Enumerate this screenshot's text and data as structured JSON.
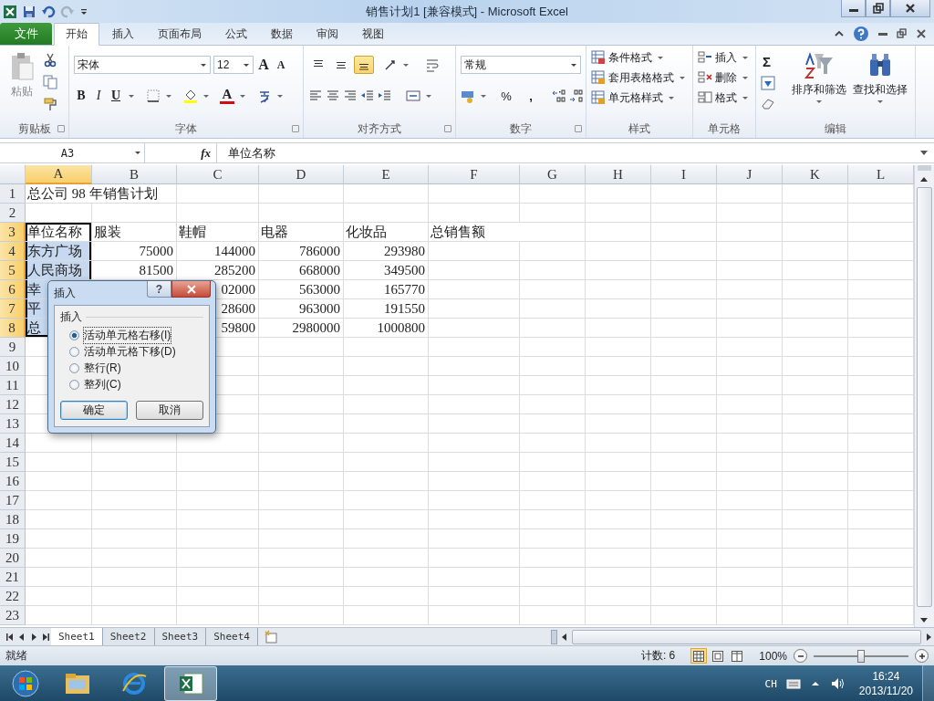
{
  "window": {
    "title": "销售计划1  [兼容模式]  -  Microsoft Excel"
  },
  "ribbon_tabs": [
    {
      "label": "文件",
      "kind": "file",
      "selected": false
    },
    {
      "label": "开始",
      "kind": "tab",
      "selected": true
    },
    {
      "label": "插入",
      "kind": "tab",
      "selected": false
    },
    {
      "label": "页面布局",
      "kind": "tab",
      "selected": false
    },
    {
      "label": "公式",
      "kind": "tab",
      "selected": false
    },
    {
      "label": "数据",
      "kind": "tab",
      "selected": false
    },
    {
      "label": "审阅",
      "kind": "tab",
      "selected": false
    },
    {
      "label": "视图",
      "kind": "tab",
      "selected": false
    }
  ],
  "clipboard": {
    "paste": "粘贴",
    "label": "剪贴板"
  },
  "font": {
    "name": "宋体",
    "size": "12",
    "grow": "A",
    "shrink": "A",
    "bold": "B",
    "italic": "I",
    "underline": "U",
    "color_letter": "A",
    "label": "字体"
  },
  "alignment": {
    "vertical": [
      {
        "kind": "top",
        "selected": false
      },
      {
        "kind": "middle",
        "selected": false
      },
      {
        "kind": "bottom",
        "selected": true
      }
    ],
    "label": "对齐方式"
  },
  "number": {
    "format": "常规",
    "percent": "%",
    "comma": ",",
    "label": "数字"
  },
  "styles": {
    "items": [
      "条件格式",
      "套用表格格式",
      "单元格样式"
    ],
    "label": "样式"
  },
  "cells": {
    "items": [
      "插入",
      "删除",
      "格式"
    ],
    "label": "单元格"
  },
  "editing": {
    "sum": "Σ",
    "items": [
      "排序和筛选",
      "查找和选择"
    ],
    "label": "编辑"
  },
  "formula_bar": {
    "name_box": "A3",
    "fx": "fx",
    "value": "单位名称"
  },
  "sheet": {
    "columns": [
      {
        "label": "A",
        "selected": true
      },
      {
        "label": "B",
        "selected": false
      },
      {
        "label": "C",
        "selected": false
      },
      {
        "label": "D",
        "selected": false
      },
      {
        "label": "E",
        "selected": false
      },
      {
        "label": "F",
        "selected": false
      },
      {
        "label": "G",
        "selected": false
      },
      {
        "label": "H",
        "selected": false
      },
      {
        "label": "I",
        "selected": false
      },
      {
        "label": "J",
        "selected": false
      },
      {
        "label": "K",
        "selected": false
      },
      {
        "label": "L",
        "selected": false
      }
    ],
    "rows": [
      {
        "num": "1",
        "selected": false,
        "cells": [
          {
            "text": "总公司 98 年销售计划",
            "kind": "text",
            "selected": false
          }
        ]
      },
      {
        "num": "2",
        "selected": false
      },
      {
        "num": "3",
        "selected": true,
        "cells": [
          {
            "text": "单位名称",
            "kind": "text",
            "selected": true
          },
          {
            "text": "服装",
            "kind": "text",
            "selected": false
          },
          {
            "text": "鞋帽",
            "kind": "text",
            "selected": false
          },
          {
            "text": "电器",
            "kind": "text",
            "selected": false
          },
          {
            "text": "化妆品",
            "kind": "text",
            "selected": false
          },
          {
            "text": "总销售额",
            "kind": "text",
            "selected": false
          }
        ]
      },
      {
        "num": "4",
        "selected": true,
        "cells": [
          {
            "text": "东方广场",
            "kind": "text",
            "selected": true
          },
          {
            "text": "75000",
            "kind": "number",
            "selected": false
          },
          {
            "text": "144000",
            "kind": "number",
            "selected": false
          },
          {
            "text": "786000",
            "kind": "number",
            "selected": false
          },
          {
            "text": "293980",
            "kind": "number",
            "selected": false
          }
        ]
      },
      {
        "num": "5",
        "selected": true,
        "cells": [
          {
            "text": "人民商场",
            "kind": "text",
            "selected": true
          },
          {
            "text": "81500",
            "kind": "number",
            "selected": false
          },
          {
            "text": "285200",
            "kind": "number",
            "selected": false
          },
          {
            "text": "668000",
            "kind": "number",
            "selected": false
          },
          {
            "text": "349500",
            "kind": "number",
            "selected": false
          }
        ]
      },
      {
        "num": "6",
        "selected": true,
        "cells": [
          {
            "text": "幸",
            "kind": "text",
            "selected": true
          },
          null,
          {
            "text": "02000",
            "kind": "number",
            "selected": false
          },
          {
            "text": "563000",
            "kind": "number",
            "selected": false
          },
          {
            "text": "165770",
            "kind": "number",
            "selected": false
          }
        ]
      },
      {
        "num": "7",
        "selected": true,
        "cells": [
          {
            "text": "平",
            "kind": "text",
            "selected": true
          },
          null,
          {
            "text": "28600",
            "kind": "number",
            "selected": false
          },
          {
            "text": "963000",
            "kind": "number",
            "selected": false
          },
          {
            "text": "191550",
            "kind": "number",
            "selected": false
          }
        ]
      },
      {
        "num": "8",
        "selected": true,
        "cells": [
          {
            "text": "总",
            "kind": "text",
            "selected": true
          },
          null,
          {
            "text": "59800",
            "kind": "number",
            "selected": false
          },
          {
            "text": "2980000",
            "kind": "number",
            "selected": false
          },
          {
            "text": "1000800",
            "kind": "number",
            "selected": false
          }
        ]
      },
      {
        "num": "9",
        "selected": false
      },
      {
        "num": "10",
        "selected": false
      },
      {
        "num": "11",
        "selected": false
      },
      {
        "num": "12",
        "selected": false
      },
      {
        "num": "13",
        "selected": false
      },
      {
        "num": "14",
        "selected": false
      },
      {
        "num": "15",
        "selected": false
      },
      {
        "num": "16",
        "selected": false
      },
      {
        "num": "17",
        "selected": false
      },
      {
        "num": "18",
        "selected": false
      },
      {
        "num": "19",
        "selected": false
      },
      {
        "num": "20",
        "selected": false
      },
      {
        "num": "21",
        "selected": false
      },
      {
        "num": "22",
        "selected": false
      },
      {
        "num": "23",
        "selected": false
      }
    ]
  },
  "dialog": {
    "title": "插入",
    "help": "?",
    "group": "插入",
    "options": [
      {
        "label": "活动单元格右移(I)",
        "selected": true
      },
      {
        "label": "活动单元格下移(D)",
        "selected": false
      },
      {
        "label": "整行(R)",
        "selected": false
      },
      {
        "label": "整列(C)",
        "selected": false
      }
    ],
    "buttons": [
      {
        "label": "确定",
        "default": true
      },
      {
        "label": "取消",
        "default": false
      }
    ]
  },
  "sheet_tabs": [
    {
      "label": "Sheet1",
      "selected": true
    },
    {
      "label": "Sheet2",
      "selected": false
    },
    {
      "label": "Sheet3",
      "selected": false
    },
    {
      "label": "Sheet4",
      "selected": false
    }
  ],
  "status_bar": {
    "ready": "就绪",
    "count": "计数: 6",
    "views": [
      {
        "kind": "normal",
        "selected": true
      },
      {
        "kind": "layout",
        "selected": false
      },
      {
        "kind": "break",
        "selected": false
      }
    ],
    "zoom": "100%",
    "zoom_slider": {
      "level": 0.5
    }
  },
  "taskbar": {
    "apps": [
      {
        "kind": "folder",
        "selected": false
      },
      {
        "kind": "browser",
        "selected": false
      },
      {
        "kind": "excel",
        "selected": true
      }
    ],
    "language": "CH",
    "time": "16:24",
    "date": "2013/11/20"
  }
}
